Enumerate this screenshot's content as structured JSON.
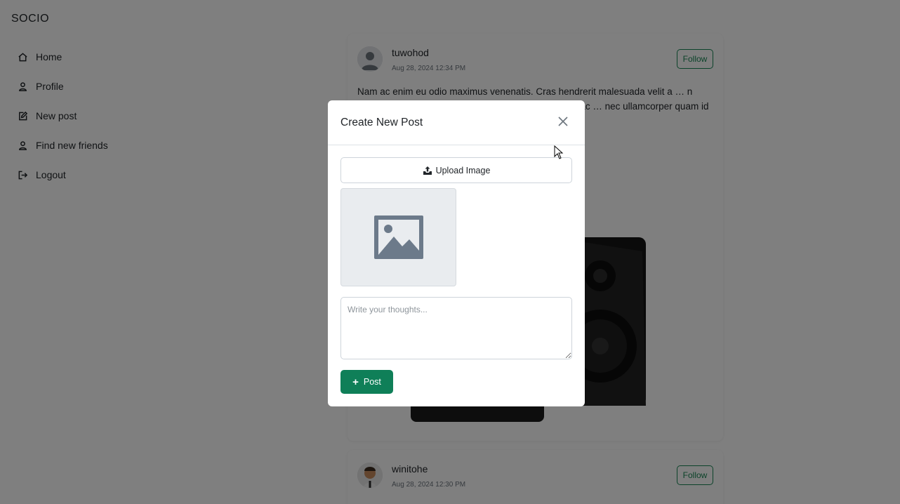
{
  "sidebar": {
    "brand": "SOCIO",
    "items": [
      {
        "label": "Home",
        "icon": "home-icon"
      },
      {
        "label": "Profile",
        "icon": "user-icon"
      },
      {
        "label": "New post",
        "icon": "edit-icon"
      },
      {
        "label": "Find new friends",
        "icon": "user-icon"
      },
      {
        "label": "Logout",
        "icon": "logout-icon"
      }
    ]
  },
  "feed": {
    "posts": [
      {
        "username": "tuwohod",
        "timestamp": "Aug 28, 2024 12:34 PM",
        "follow_label": "Follow",
        "text": "Nam ac enim eu odio maximus venenatis. Cras hendrerit malesuada velit a … n commodo eget ante sit … rra lobortis id eros. Mauris ac … nec ullamcorper quam id … magna tempor, fermentum",
        "image": "speaker"
      },
      {
        "username": "winitohe",
        "timestamp": "Aug 28, 2024 12:30 PM",
        "follow_label": "Follow"
      }
    ]
  },
  "modal": {
    "title": "Create New Post",
    "upload_label": "Upload Image",
    "textarea_placeholder": "Write your thoughts...",
    "post_label": "Post",
    "icons": [
      "close-icon",
      "upload-icon",
      "image-placeholder-icon",
      "plus-icon"
    ]
  },
  "colors": {
    "accent": "#0f7f58",
    "follow": "#198754",
    "overlay": "rgba(0,0,0,0.5)"
  }
}
